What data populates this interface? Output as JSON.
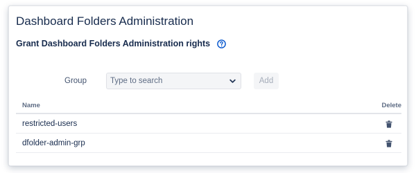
{
  "page": {
    "title": "Dashboard Folders Administration",
    "section_title": "Grant Dashboard Folders Administration rights"
  },
  "form": {
    "group_label": "Group",
    "group_select": {
      "placeholder": "Type to search",
      "value": ""
    },
    "add_label": "Add"
  },
  "table": {
    "headers": {
      "name": "Name",
      "delete": "Delete"
    },
    "rows": [
      {
        "name": "restricted-users"
      },
      {
        "name": "dfolder-admin-grp"
      }
    ]
  },
  "icons": {
    "help": "help-circle-icon",
    "dropdown": "chevron-down-icon",
    "delete": "trash-icon"
  },
  "colors": {
    "accent": "#0052cc",
    "text": "#172b4d",
    "muted": "#5e6c84"
  }
}
